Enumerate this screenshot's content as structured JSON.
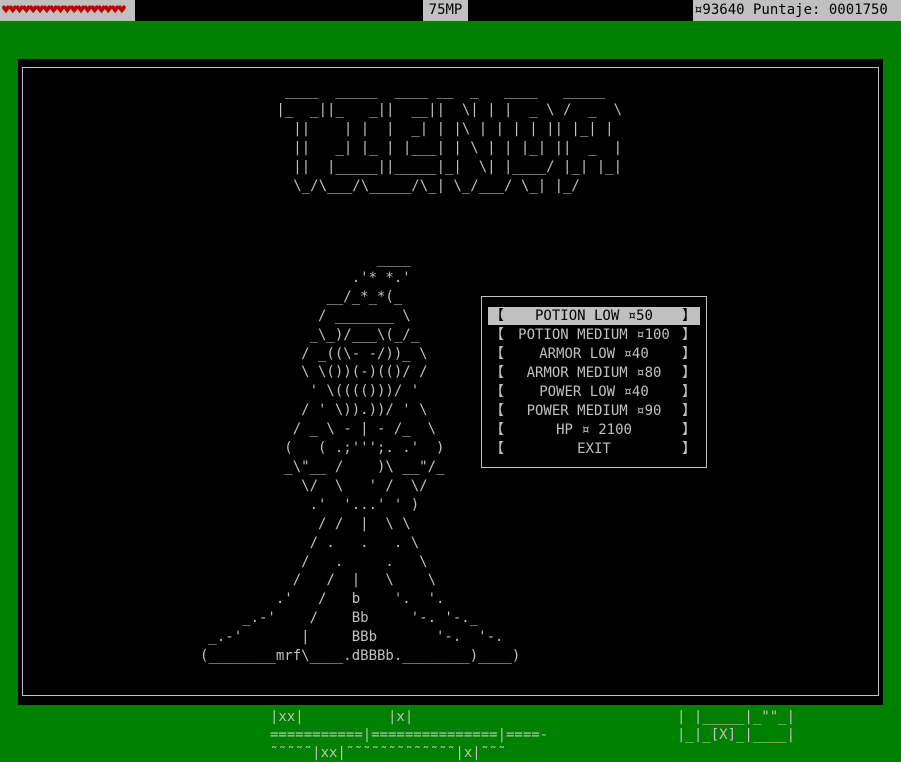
{
  "status_bar": {
    "hearts": "♥♥♥♥♥♥♥♥♥♥♥♥♥♥♥♥♥♥",
    "mp": "75MP",
    "money_score": "¤93640 Puntaje: 0001750"
  },
  "shop": {
    "title_art": "  ____  _____  ____ __  _   ____   _____\n |_  _||_   _||  __||  \\| | |  _ \\ /  _  \\\n   ||    | |  |  _| | |\\ | | | | || |_| |\n   ||   _| |_ | |___| | \\ | | |_| ||  _  |\n   ||  |_____||_____|_|  \\| |____/ |_| |_|\n   \\_/\\___/\\_____/\\_| \\_/___/ \\_| |_/",
    "figure_art": "                     ____\n                  .'* *.'\n               __/_*_*(_\n              / _______ \\\n             _\\_)/___\\(_/_\n            / _((\\- -/))_ \\\n            \\ \\())(-)(()/ /\n             ' \\(((()))/ '\n            / ' \\)).))/ ' \\\n           / _ \\ - | - /_  \\\n          (   ( .;''';. .'  )\n          _\\\"__ /    )\\ __\"/_\n            \\/  \\   ' /  \\/\n             .'  '...' ' )\n              / /  |  \\ \\\n             / .   .   . \\\n            /   .     .   \\\n           /   /  |   \\    \\\n         .'   /   b    '.  '.\n     _.-'    /    Bb     '-. '-._\n _.-'       |     BBb       '-.  '-.\n(________mrf\\____.dBBBb.________)____)",
    "menu": [
      {
        "label": "POTION LOW ¤50"
      },
      {
        "label": "POTION MEDIUM ¤100"
      },
      {
        "label": "ARMOR LOW ¤40"
      },
      {
        "label": "ARMOR MEDIUM ¤80"
      },
      {
        "label": "POWER LOW ¤40"
      },
      {
        "label": "POWER MEDIUM ¤90"
      },
      {
        "label": "HP ¤ 2100"
      },
      {
        "label": "EXIT"
      }
    ],
    "selected_index": 0,
    "bracket_left": "【",
    "bracket_right": "】"
  },
  "map_fragments": {
    "left": "|xx|          |x|\n===========|===============|====-\n˜˜˜˜˜|xx|˜˜˜˜˜˜˜˜˜˜˜˜˜|x|˜˜˜",
    "right": "| |_____|_\"\"_|\n|_|_[X]_|____|"
  }
}
